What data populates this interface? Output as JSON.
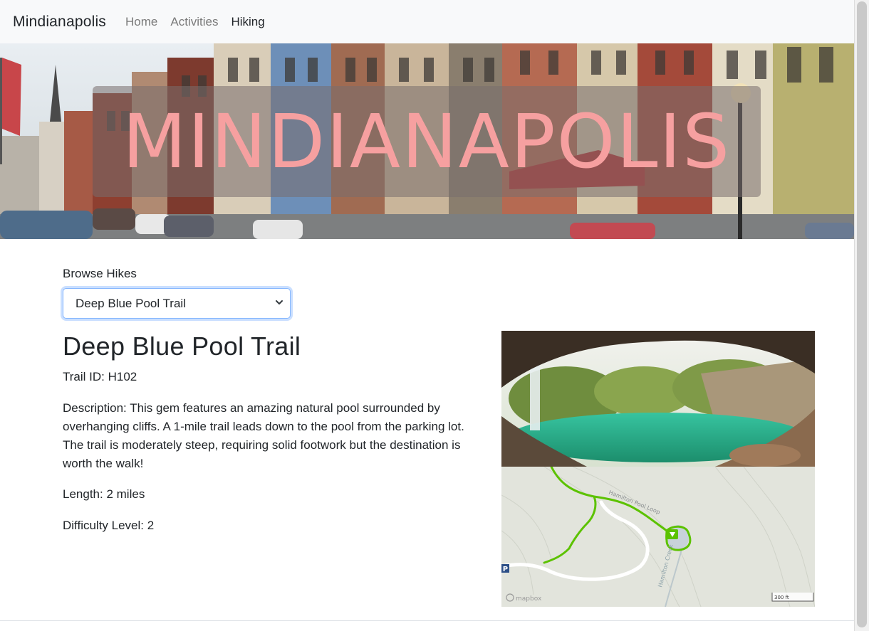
{
  "nav": {
    "brand": "Mindianapolis",
    "links": [
      "Home",
      "Activities",
      "Hiking"
    ],
    "active": "Hiking"
  },
  "hero": {
    "title": "MINDIANAPOLIS"
  },
  "browse": {
    "label": "Browse Hikes",
    "selected": "Deep Blue Pool Trail"
  },
  "hike": {
    "name": "Deep Blue Pool Trail",
    "id_label": "Trail ID:",
    "id": "H102",
    "desc_label": "Description:",
    "description": "This gem features an amazing natural pool surrounded by overhanging cliffs. A 1-mile trail leads down to the pool from the parking lot. The trail is moderately steep, requiring solid footwork but the destination is worth the walk!",
    "length_label": "Length:",
    "length": "2 miles",
    "difficulty_label": "Difficulty Level:",
    "difficulty": "2"
  },
  "map": {
    "trail_label": "Hamilton Pool Loop",
    "scale": "300 ft",
    "attribution": "mapbox",
    "creek_label": "Hamilton Creek",
    "parking_symbol": "P"
  },
  "colors": {
    "navbar_bg": "#f8f9fa",
    "hero_title": "#f6a0a0",
    "select_focus": "#86b7fe",
    "trail": "#5cc200"
  },
  "icons": {
    "select": "chevron-down-icon",
    "parking": "parking-icon",
    "pool": "diamond-marker-icon"
  }
}
